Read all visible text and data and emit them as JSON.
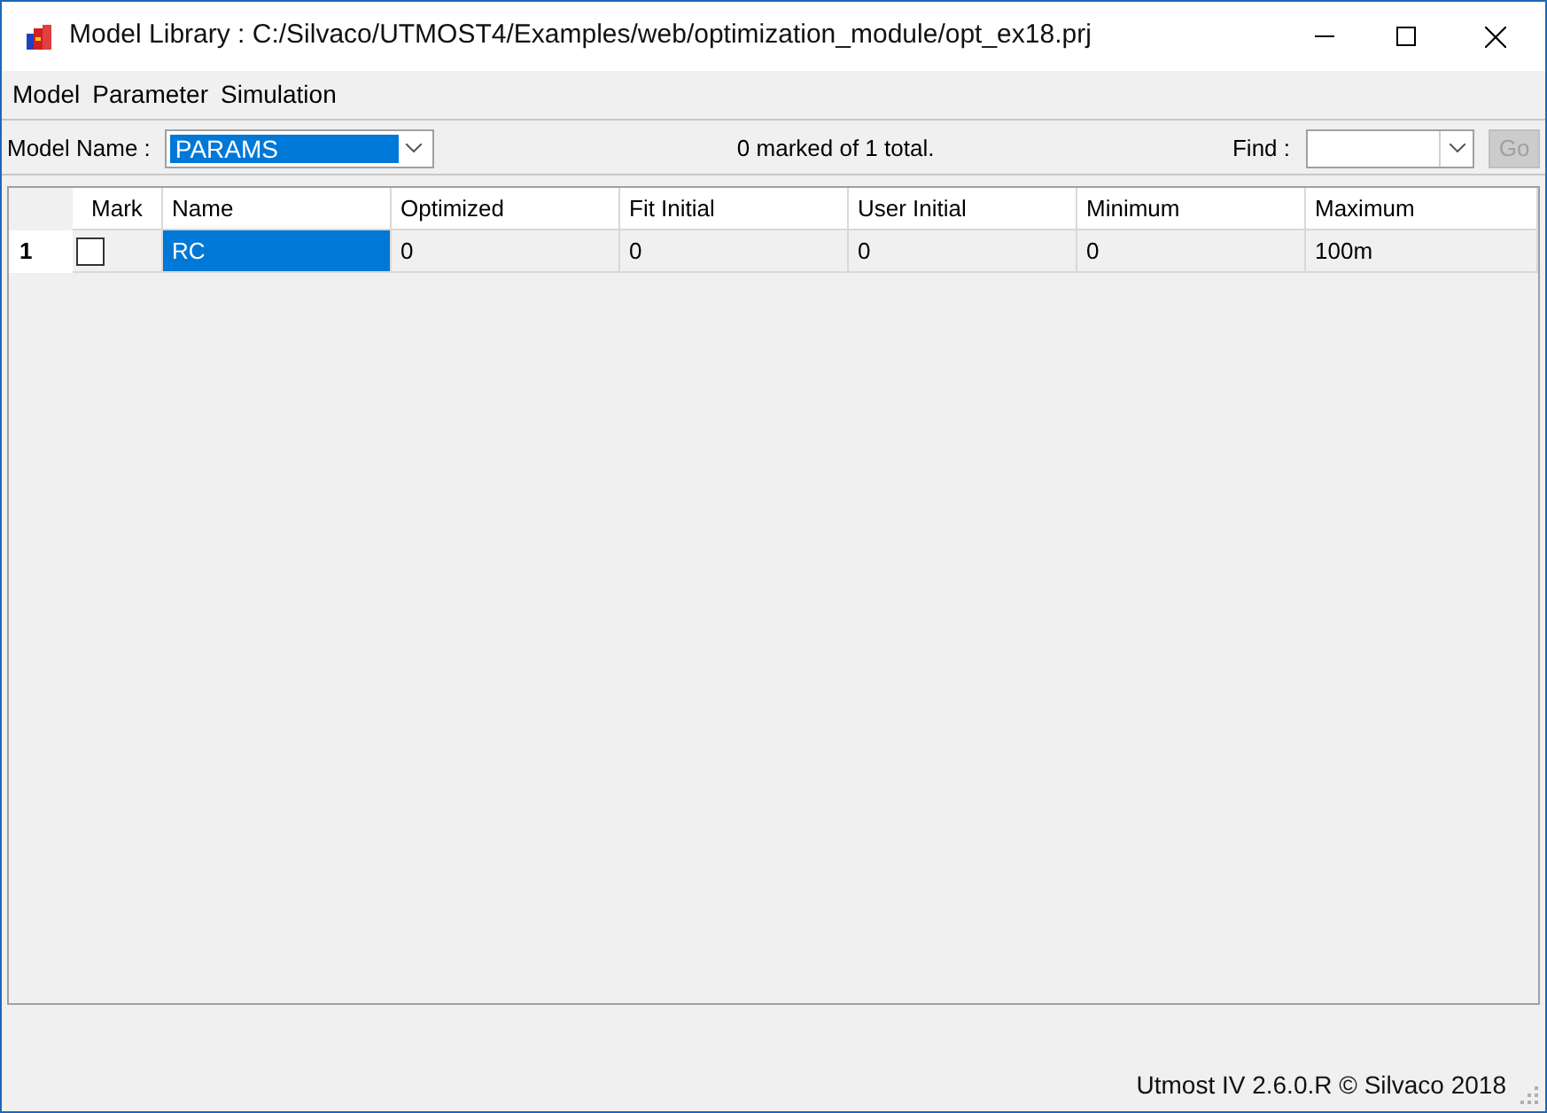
{
  "window": {
    "title": "Model Library : C:/Silvaco/UTMOST4/Examples/web/optimization_module/opt_ex18.prj"
  },
  "menu": [
    "Model",
    "Parameter",
    "Simulation"
  ],
  "toolbar": {
    "model_label": "Model Name :",
    "model_value": "PARAMS",
    "summary": "0 marked of 1 total.",
    "find_label": "Find :",
    "go_button": "Go",
    "go_disabled": true
  },
  "table": {
    "columns": [
      "",
      "Mark",
      "Name",
      "Optimized",
      "Fit Initial",
      "User Initial",
      "Minimum",
      "Maximum"
    ],
    "rows": [
      {
        "checked": false,
        "selected": true,
        "cells": [
          "1",
          "",
          "RC",
          "0",
          "0",
          "0",
          "0",
          "100m"
        ]
      }
    ]
  },
  "status_bar": "Utmost IV 2.6.0.R © Silvaco 2018"
}
